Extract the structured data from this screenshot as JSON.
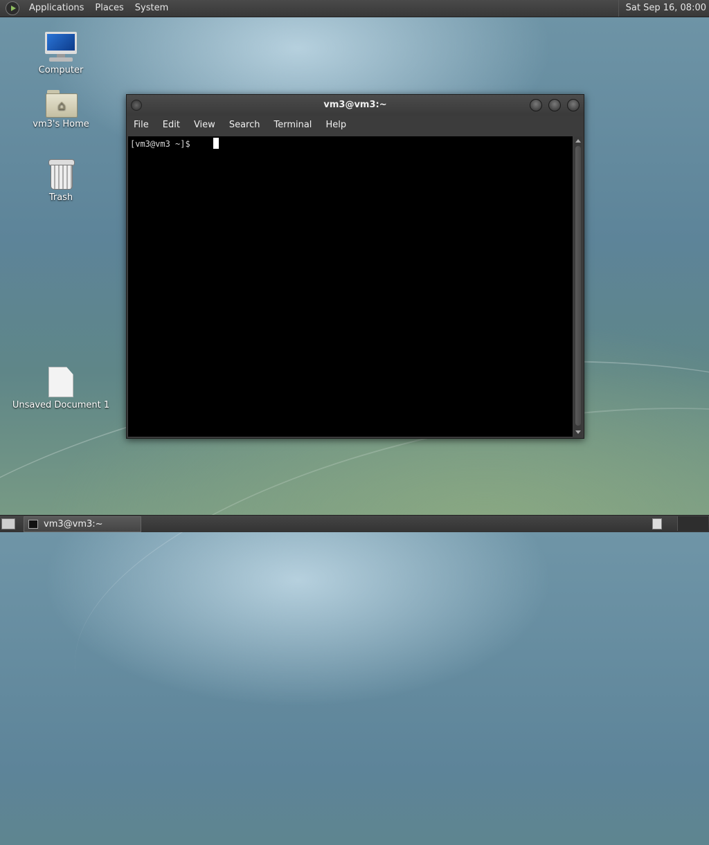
{
  "top_panel": {
    "menus": [
      "Applications",
      "Places",
      "System"
    ],
    "clock": "Sat Sep 16, 08:00"
  },
  "desktop": {
    "icons": [
      {
        "label": "Computer",
        "icon": "computer-icon"
      },
      {
        "label": "vm3's Home",
        "icon": "home-folder-icon"
      },
      {
        "label": "Trash",
        "icon": "trash-icon"
      },
      {
        "label": "Unsaved Document 1",
        "icon": "document-icon"
      }
    ]
  },
  "terminal": {
    "title": "vm3@vm3:~",
    "menu": [
      "File",
      "Edit",
      "View",
      "Search",
      "Terminal",
      "Help"
    ],
    "prompt": "[vm3@vm3 ~]$"
  },
  "taskbar": {
    "task_label": "vm3@vm3:~"
  }
}
